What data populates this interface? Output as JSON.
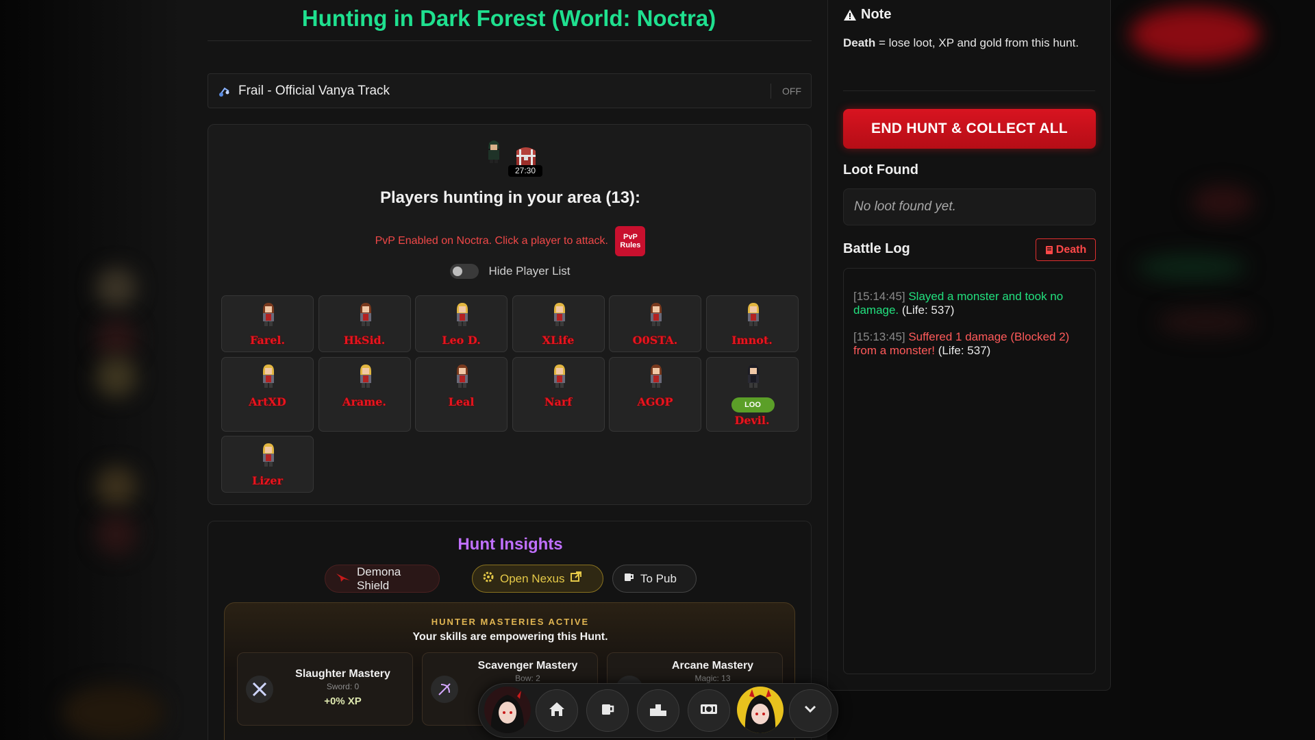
{
  "page": {
    "title": "Hunting in Dark Forest (World: Noctra)"
  },
  "music": {
    "track": "Frail - Official Vanya Track",
    "toggle": "OFF"
  },
  "players": {
    "chest_timer": "27:30",
    "heading": "Players hunting in your area (13):",
    "pvp_notice": "PvP Enabled on Noctra. Click a player to attack.",
    "pvp_rules_top": "PvP",
    "pvp_rules_bottom": "Rules",
    "hide_label": "Hide Player List",
    "list": [
      {
        "name": "Farel.",
        "hair": "brown"
      },
      {
        "name": "HkSid.",
        "hair": "brown"
      },
      {
        "name": "Leo D.",
        "hair": "blonde"
      },
      {
        "name": "XLife",
        "hair": "blonde"
      },
      {
        "name": "O0STA.",
        "hair": "brown"
      },
      {
        "name": "Imnot.",
        "hair": "blonde"
      },
      {
        "name": "ArtXD",
        "hair": "blonde"
      },
      {
        "name": "Arame.",
        "hair": "blonde"
      },
      {
        "name": "Leal",
        "hair": "brown"
      },
      {
        "name": "Narf",
        "hair": "blonde"
      },
      {
        "name": "AGOP",
        "hair": "brown"
      },
      {
        "name": "Devil.",
        "hair": "dark",
        "badge": "LOO"
      },
      {
        "name": "Lizer",
        "hair": "blonde"
      }
    ]
  },
  "insights": {
    "title": "Hunt Insights",
    "buttons": {
      "shield": "Demona Shield",
      "nexus": "Open Nexus",
      "pub": "To Pub"
    },
    "mastery_heading": "HUNTER MASTERIES ACTIVE",
    "mastery_sub": "Your skills are empowering this Hunt.",
    "masteries": [
      {
        "name": "Slaughter Mastery",
        "skill": "Sword: 0",
        "bonus": "+0% XP"
      },
      {
        "name": "Scavenger Mastery",
        "skill": "Bow: 2",
        "bonus": ""
      },
      {
        "name": "Arcane Mastery",
        "skill": "Magic: 13",
        "bonus": ""
      }
    ]
  },
  "sidebar": {
    "note_title": "Note",
    "note_bold": "Death",
    "note_rest": " = lose loot, XP and gold from this hunt.",
    "end_button": "END HUNT & COLLECT ALL",
    "loot_label": "Loot Found",
    "loot_empty": "No loot found yet.",
    "battle_label": "Battle Log",
    "death_button": "Death",
    "log": [
      {
        "time": "[15:14:45]",
        "msg": "Slayed a monster and took no damage.",
        "life": "(Life: 537)",
        "kind": "ok"
      },
      {
        "time": "[15:13:45]",
        "msg": "Suffered 1 damage (Blocked 2) from a monster!",
        "life": "(Life: 537)",
        "kind": "bad"
      }
    ]
  },
  "colors": {
    "title_green": "#1fe08f",
    "accent_red": "#c8102e",
    "player_name_red": "#e8141f",
    "insights_purple": "#c070ff",
    "mastery_gold": "#e0b552"
  },
  "dock": {
    "icons": [
      "avatar-left",
      "home-icon",
      "mug-icon",
      "podium-icon",
      "tickets-icon",
      "avatar-right",
      "chevron-down-icon"
    ]
  }
}
